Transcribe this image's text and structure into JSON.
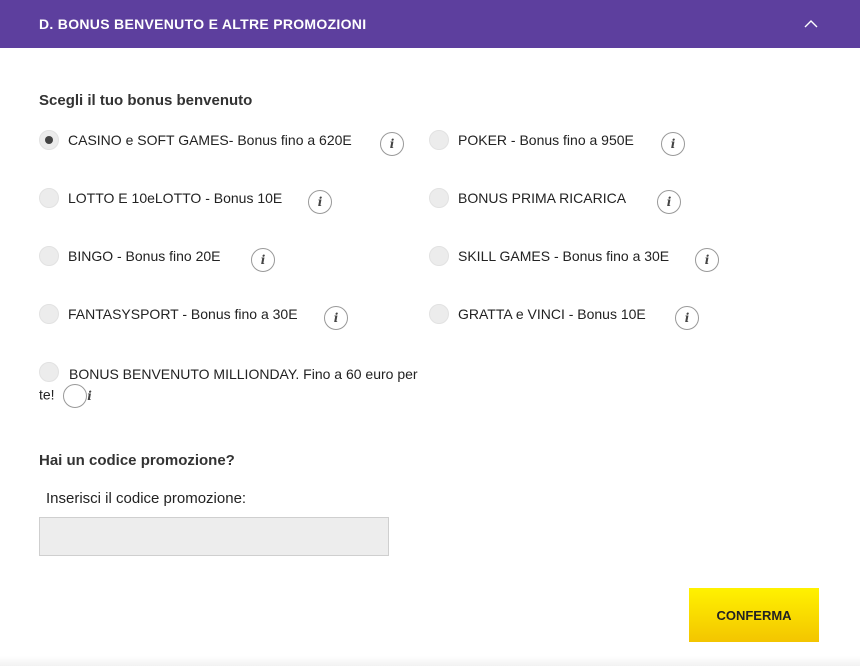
{
  "header": {
    "title": "D. BONUS BENVENUTO E ALTRE PROMOZIONI",
    "chevron_icon": "chevron-up-icon"
  },
  "welcome": {
    "title": "Scegli il tuo bonus benvenuto",
    "options": [
      {
        "label": "CASINO e SOFT GAMES- Bonus fino a 620E",
        "checked": true
      },
      {
        "label": "POKER - Bonus fino a 950E",
        "checked": false
      },
      {
        "label": "LOTTO E 10eLOTTO - Bonus 10E",
        "checked": false
      },
      {
        "label": "BONUS PRIMA RICARICA",
        "checked": false
      },
      {
        "label": "BINGO - Bonus fino 20E",
        "checked": false
      },
      {
        "label": "SKILL GAMES - Bonus fino a 30E",
        "checked": false
      },
      {
        "label": "FANTASYSPORT - Bonus fino a 30E",
        "checked": false
      },
      {
        "label": "GRATTA e VINCI - Bonus 10E",
        "checked": false
      },
      {
        "label": "BONUS BENVENUTO MILLIONDAY. Fino a 60 euro per te!",
        "checked": false
      }
    ],
    "info_icon": "info-icon",
    "info_glyph": "i"
  },
  "promo": {
    "title": "Hai un codice promozione?",
    "input_label": "Inserisci il codice promozione:",
    "input_value": "",
    "input_placeholder": ""
  },
  "confirm_button": {
    "label": "CONFERMA"
  },
  "colors": {
    "header_bg": "#5d3f9e",
    "confirm_bg": "#fde800"
  }
}
